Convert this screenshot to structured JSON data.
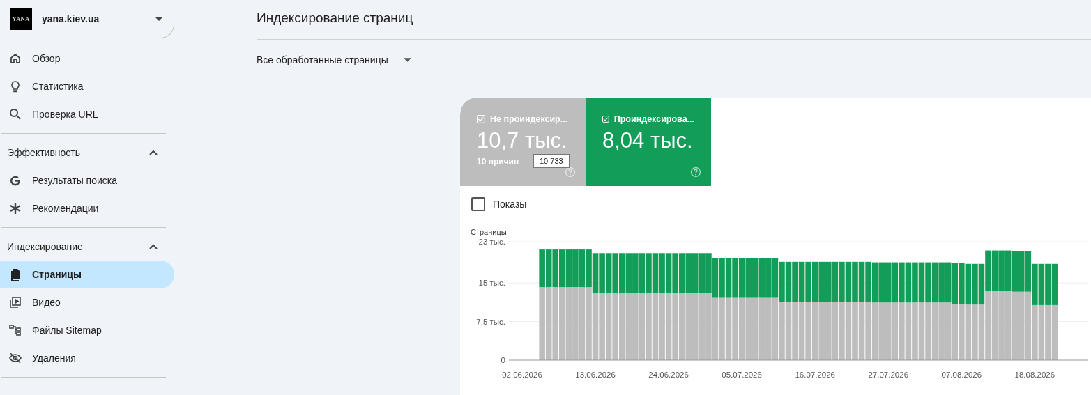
{
  "property": {
    "logo_text": "YANA",
    "name": "yana.kiev.ua"
  },
  "sidebar": {
    "items": [
      {
        "kind": "home",
        "label": "Обзор",
        "selected": false
      },
      {
        "kind": "bulb",
        "label": "Статистика",
        "selected": false
      },
      {
        "kind": "search",
        "label": "Проверка URL",
        "selected": false
      }
    ],
    "sections": [
      {
        "title": "Эффективность",
        "expanded": true,
        "items": [
          {
            "kind": "google",
            "label": "Результаты поиска",
            "selected": false
          },
          {
            "kind": "asterisk",
            "label": "Рекомендации",
            "selected": false
          }
        ]
      },
      {
        "title": "Индексирование",
        "expanded": true,
        "items": [
          {
            "kind": "pages",
            "label": "Страницы",
            "selected": true
          },
          {
            "kind": "video",
            "label": "Видео",
            "selected": false
          },
          {
            "kind": "sitemap",
            "label": "Файлы Sitemap",
            "selected": false
          },
          {
            "kind": "hidden",
            "label": "Удаления",
            "selected": false
          }
        ]
      }
    ]
  },
  "page_title": "Индексирование страниц",
  "filter": {
    "label": "Все обработанные страницы"
  },
  "tiles": [
    {
      "label": "Не проиндексир...",
      "value": "10,7 тыс.",
      "sub": "10 причин",
      "checked": true,
      "color": "#bdbdbd"
    },
    {
      "label": "Проиндексирова...",
      "value": "8,04 тыс.",
      "checked": true,
      "color": "#129d58"
    }
  ],
  "tooltip": "10 733",
  "impressions": {
    "label": "Показы",
    "checked": false
  },
  "chart_data": {
    "type": "bar",
    "stacked": true,
    "ylabel": "Страницы",
    "ylim": [
      0,
      23
    ],
    "yticks": [
      {
        "value": 0,
        "label": "0"
      },
      {
        "value": 7.5,
        "label": "7,5 тыс."
      },
      {
        "value": 15,
        "label": "15 тыс."
      },
      {
        "value": 23,
        "label": "23 тыс."
      }
    ],
    "categories": [
      "02.06.2026",
      null,
      null,
      null,
      null,
      null,
      null,
      null,
      null,
      null,
      null,
      "13.06.2026",
      null,
      null,
      null,
      null,
      null,
      null,
      null,
      null,
      null,
      null,
      "24.06.2026",
      null,
      null,
      null,
      null,
      null,
      null,
      null,
      null,
      null,
      null,
      "05.07.2026",
      null,
      null,
      null,
      null,
      null,
      null,
      null,
      null,
      null,
      null,
      "16.07.2026",
      null,
      null,
      null,
      null,
      null,
      null,
      null,
      null,
      null,
      null,
      "27.07.2026",
      null,
      null,
      null,
      null,
      null,
      null,
      null,
      null,
      null,
      null,
      "07.08.2026",
      null,
      null,
      null,
      null,
      null,
      null,
      null,
      null,
      null,
      null,
      "18.08.2026",
      null,
      null,
      null
    ],
    "series": [
      {
        "color": "#bdbdbd",
        "values": [
          null,
          null,
          null,
          14.2,
          14.2,
          14.2,
          14.2,
          14.2,
          14.2,
          14.2,
          14.2,
          13.1,
          13.1,
          13.1,
          13.1,
          13.1,
          13.1,
          13.1,
          13.1,
          13.1,
          13.1,
          13.1,
          13.1,
          13.1,
          13.1,
          13.1,
          13.1,
          13.1,
          13.1,
          12.1,
          12.1,
          12.1,
          12.1,
          12.1,
          12.1,
          12.1,
          12.1,
          12.1,
          12.1,
          11.3,
          11.3,
          11.3,
          11.3,
          11.3,
          11.3,
          11.3,
          11.3,
          11.3,
          11.3,
          11.3,
          11.3,
          11.3,
          11.3,
          11.2,
          11.2,
          11.2,
          11.2,
          11.2,
          11.2,
          11.2,
          11.2,
          11.2,
          11.2,
          11.2,
          11.2,
          10.9,
          10.9,
          10.8,
          10.8,
          10.8,
          13.5,
          13.5,
          13.5,
          13.5,
          13.3,
          13.3,
          13.3,
          10.7,
          10.7,
          10.7,
          10.7
        ]
      },
      {
        "color": "#129d58",
        "values": [
          null,
          null,
          null,
          7.3,
          7.3,
          7.3,
          7.3,
          7.3,
          7.3,
          7.3,
          7.3,
          7.7,
          7.7,
          7.7,
          7.7,
          7.7,
          7.7,
          7.7,
          7.7,
          7.7,
          7.7,
          7.7,
          7.7,
          7.7,
          7.7,
          7.7,
          7.7,
          7.7,
          7.7,
          7.7,
          7.7,
          7.7,
          7.7,
          7.7,
          7.7,
          7.7,
          7.7,
          7.7,
          7.7,
          7.8,
          7.8,
          7.8,
          7.8,
          7.8,
          7.8,
          7.8,
          7.8,
          7.8,
          7.8,
          7.8,
          7.8,
          7.8,
          7.8,
          7.8,
          7.8,
          7.8,
          7.8,
          7.8,
          7.8,
          7.8,
          7.8,
          7.8,
          7.8,
          7.8,
          7.8,
          8.0,
          8.0,
          7.9,
          7.9,
          7.9,
          7.8,
          7.8,
          7.8,
          7.8,
          7.9,
          7.9,
          7.9,
          8.0,
          8.0,
          8.0,
          8.0
        ]
      }
    ]
  }
}
